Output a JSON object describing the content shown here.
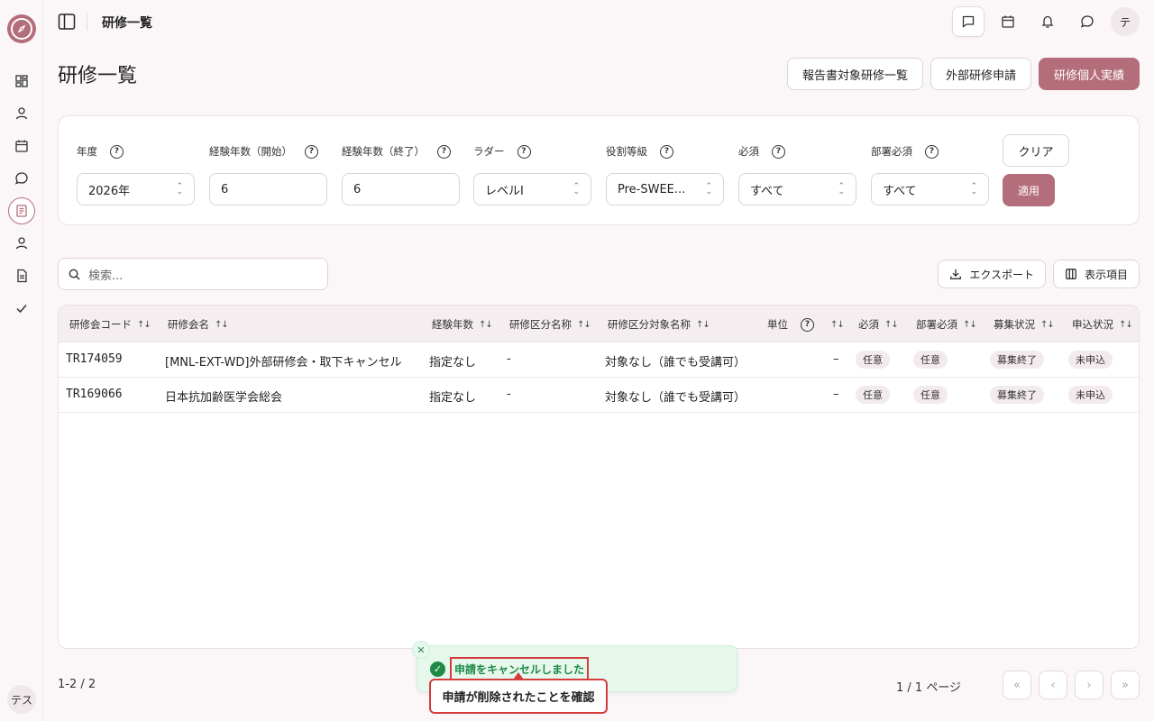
{
  "app": {
    "user_initial": "テ",
    "sidebar_user": "テス"
  },
  "topbar": {
    "title": "研修一覧"
  },
  "page": {
    "title": "研修一覧"
  },
  "header_buttons": {
    "report_list": "報告書対象研修一覧",
    "external_apply": "外部研修申請",
    "personal_record": "研修個人実績"
  },
  "filters": [
    {
      "label": "年度",
      "value": "2026年",
      "type": "select"
    },
    {
      "label": "経験年数（開始）",
      "value": "6",
      "type": "input"
    },
    {
      "label": "経験年数（終了）",
      "value": "6",
      "type": "input"
    },
    {
      "label": "ラダー",
      "value": "レベルI",
      "type": "select"
    },
    {
      "label": "役割等級",
      "value": "Pre-SWEE...",
      "type": "select"
    },
    {
      "label": "必須",
      "value": "すべて",
      "type": "select"
    },
    {
      "label": "部署必須",
      "value": "すべて",
      "type": "select"
    }
  ],
  "filter_actions": {
    "clear": "クリア",
    "apply": "適用"
  },
  "search": {
    "placeholder": "検索..."
  },
  "table_tools": {
    "export": "エクスポート",
    "columns": "表示項目"
  },
  "table": {
    "headers": [
      "研修会コード",
      "研修会名",
      "経験年数",
      "研修区分名称",
      "研修区分対象名称",
      "単位",
      "必須",
      "部署必須",
      "募集状況",
      "申込状況"
    ],
    "rows": [
      {
        "code": "TR174059",
        "name": "[MNL-EXT-WD]外部研修会・取下キャンセル",
        "years": "指定なし",
        "category": "-",
        "target": "対象なし（誰でも受講可）",
        "unit": "–",
        "required": "任意",
        "dept_required": "任意",
        "recruit": "募集終了",
        "apply": "未申込"
      },
      {
        "code": "TR169066",
        "name": "日本抗加齢医学会総会",
        "years": "指定なし",
        "category": "-",
        "target": "対象なし（誰でも受講可）",
        "unit": "–",
        "required": "任意",
        "dept_required": "任意",
        "recruit": "募集終了",
        "apply": "未申込"
      }
    ]
  },
  "footer": {
    "count": "1-2 / 2",
    "page_info": "1 / 1 ページ"
  },
  "toast": {
    "message": "申請をキャンセルしました"
  },
  "callout": {
    "text": "申請が削除されたことを確認"
  },
  "colors": {
    "accent": "#b46d7b",
    "toast_bg": "#e6f8ec",
    "toast_text": "#1e8a46",
    "highlight": "#d63c3c"
  }
}
